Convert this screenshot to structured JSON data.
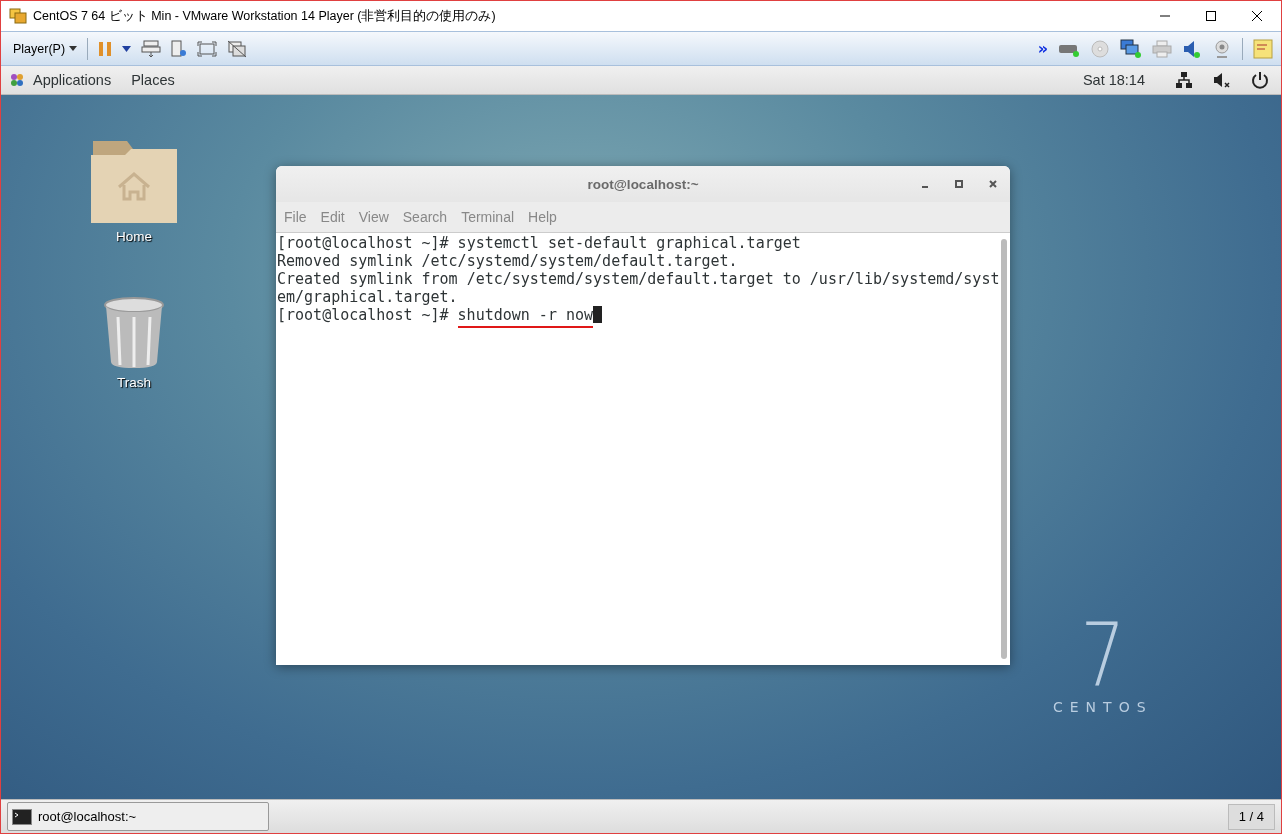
{
  "window": {
    "title": "CentOS 7 64 ビット Min - VMware Workstation 14 Player (非営利目的の使用のみ)"
  },
  "toolbar": {
    "player_menu": "Player(P)",
    "more": "»"
  },
  "top_bar": {
    "menus": [
      "Applications",
      "Places"
    ],
    "clock": "Sat 18:14"
  },
  "desktop_icons": [
    {
      "kind": "folder",
      "label": "Home"
    },
    {
      "kind": "trash",
      "label": "Trash"
    }
  ],
  "terminal": {
    "title": "root@localhost:~",
    "menu": [
      "File",
      "Edit",
      "View",
      "Search",
      "Terminal",
      "Help"
    ],
    "lines": [
      "[root@localhost ~]# systemctl set-default graphical.target",
      "Removed symlink /etc/systemd/system/default.target.",
      "Created symlink from /etc/systemd/system/default.target to /usr/lib/systemd/syst",
      "em/graphical.target."
    ],
    "current": {
      "prompt": "[root@localhost ~]#",
      "command": "shutdown -r now",
      "underlined": true
    }
  },
  "logo": {
    "number": "7",
    "word": "CENTOS"
  },
  "taskbar": {
    "task": "root@localhost:~",
    "workspace": "1 / 4"
  }
}
